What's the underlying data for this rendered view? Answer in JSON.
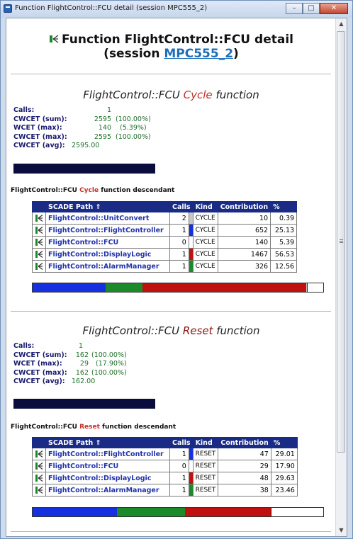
{
  "window": {
    "title": "Function FlightControl::FCU detail (session MPC555_2)",
    "buttons": {
      "minimize": "–",
      "maximize": "□",
      "close": "✕"
    }
  },
  "header": {
    "prefix": "Function FlightControl::FCU detail",
    "session_open": "(session ",
    "session_link": "MPC555_2",
    "session_close": ")"
  },
  "sections": [
    {
      "title_pre": "FlightControl::FCU ",
      "title_kind": "Cycle",
      "title_post": " function",
      "stats": {
        "calls_label": "Calls:",
        "calls_value": "1",
        "cwcet_sum_label": "CWCET (sum):",
        "cwcet_sum_value": "2595",
        "cwcet_sum_pct": "(100.00%)",
        "wcet_max_label": "WCET (max):",
        "wcet_max_value": "140",
        "wcet_max_pct": "(5.39%)",
        "cwcet_max_label": "CWCET (max):",
        "cwcet_max_value": "2595",
        "cwcet_max_pct": "(100.00%)",
        "cwcet_avg_label": "CWCET (avg):",
        "cwcet_avg_value": "2595.00"
      },
      "desc_pre": "FlightControl::FCU ",
      "desc_kind": "Cycle",
      "desc_post": " function descendant",
      "columns": [
        "SCADE Path ⇑",
        "Calls",
        "Kind",
        "Contribution",
        "%"
      ],
      "rows": [
        {
          "path": "FlightControl::UnitConvert",
          "calls": "2",
          "color": "#c8c8c8",
          "kind": "CYCLE",
          "contribution": "10",
          "pct": "0.39"
        },
        {
          "path": "FlightControl::FlightController",
          "calls": "1",
          "color": "#1530e0",
          "kind": "CYCLE",
          "contribution": "652",
          "pct": "25.13"
        },
        {
          "path": "FlightControl::FCU",
          "calls": "0",
          "color": "#ffffff",
          "kind": "CYCLE",
          "contribution": "140",
          "pct": "5.39"
        },
        {
          "path": "FlightControl::DisplayLogic",
          "calls": "1",
          "color": "#c01010",
          "kind": "CYCLE",
          "contribution": "1467",
          "pct": "56.53"
        },
        {
          "path": "FlightControl::AlarmManager",
          "calls": "1",
          "color": "#1a8a2a",
          "kind": "CYCLE",
          "contribution": "326",
          "pct": "12.56"
        }
      ],
      "stack": [
        {
          "name": "FlightController",
          "percent": 25.13,
          "color": "#1530e0"
        },
        {
          "name": "AlarmManager",
          "percent": 12.56,
          "color": "#1a8a2a"
        },
        {
          "name": "DisplayLogic",
          "percent": 56.53,
          "color": "#c01010"
        },
        {
          "name": "UnitConvert",
          "percent": 0.39,
          "color": "#c8c8c8"
        },
        {
          "name": "FCU",
          "percent": 5.39,
          "color": "#ffffff"
        }
      ]
    },
    {
      "title_pre": "FlightControl::FCU ",
      "title_kind": "Reset",
      "title_post": " function",
      "stats": {
        "calls_label": "Calls:",
        "calls_value": "1",
        "cwcet_sum_label": "CWCET (sum):",
        "cwcet_sum_value": "162",
        "cwcet_sum_pct": "(100.00%)",
        "wcet_max_label": "WCET (max):",
        "wcet_max_value": "29",
        "wcet_max_pct": "(17.90%)",
        "cwcet_max_label": "CWCET (max):",
        "cwcet_max_value": "162",
        "cwcet_max_pct": "(100.00%)",
        "cwcet_avg_label": "CWCET (avg):",
        "cwcet_avg_value": "162.00"
      },
      "desc_pre": "FlightControl::FCU ",
      "desc_kind": "Reset",
      "desc_post": " function descendant",
      "columns": [
        "SCADE Path ⇑",
        "Calls",
        "Kind",
        "Contribution",
        "%"
      ],
      "rows": [
        {
          "path": "FlightControl::FlightController",
          "calls": "1",
          "color": "#1530e0",
          "kind": "RESET",
          "contribution": "47",
          "pct": "29.01"
        },
        {
          "path": "FlightControl::FCU",
          "calls": "0",
          "color": "#ffffff",
          "kind": "RESET",
          "contribution": "29",
          "pct": "17.90"
        },
        {
          "path": "FlightControl::DisplayLogic",
          "calls": "1",
          "color": "#c01010",
          "kind": "RESET",
          "contribution": "48",
          "pct": "29.63"
        },
        {
          "path": "FlightControl::AlarmManager",
          "calls": "1",
          "color": "#1a8a2a",
          "kind": "RESET",
          "contribution": "38",
          "pct": "23.46"
        }
      ],
      "stack": [
        {
          "name": "FlightController",
          "percent": 29.01,
          "color": "#1530e0"
        },
        {
          "name": "AlarmManager",
          "percent": 23.46,
          "color": "#1a8a2a"
        },
        {
          "name": "DisplayLogic",
          "percent": 29.63,
          "color": "#c01010"
        },
        {
          "name": "FCU",
          "percent": 17.9,
          "color": "#ffffff"
        }
      ]
    }
  ],
  "icons": {
    "operator": "scade-operator-icon",
    "window": "app-window-icon"
  }
}
